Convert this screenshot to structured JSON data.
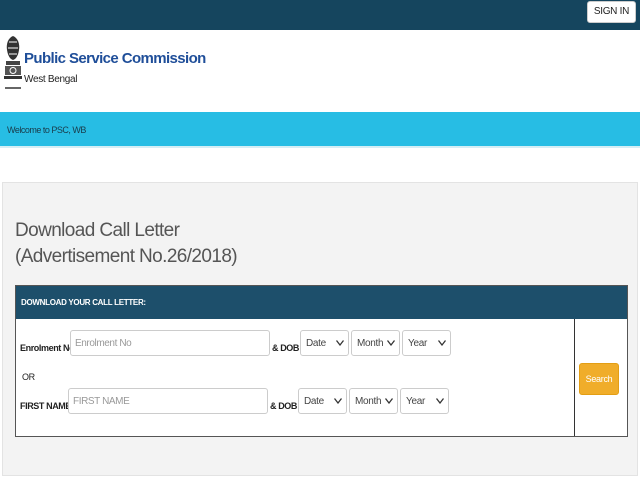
{
  "topbar": {
    "signin_label": "SIGN IN"
  },
  "header": {
    "org_name": "Public Service Commission",
    "org_region": "West Bengal"
  },
  "welcome": {
    "text": "Welcome to PSC, WB"
  },
  "page": {
    "title_line1": "Download Call Letter",
    "title_line2": "(Advertisement No.26/2018)"
  },
  "form": {
    "heading": "DOWNLOAD YOUR CALL LETTER:",
    "enrolment_label": "Enrolment No :",
    "enrolment_placeholder": "Enrolment No",
    "dob_label": "& DOB :",
    "or_label": "OR",
    "firstname_label": "FIRST NAME :",
    "firstname_placeholder": "FIRST NAME",
    "date_option": "Date",
    "month_option": "Month",
    "year_option": "Year",
    "search_label": "Search"
  },
  "colors": {
    "topbar": "#15455e",
    "brand": "#1f4e99",
    "welcome_bar": "#27bde4",
    "form_header": "#1d4f6b",
    "search_button": "#f0ad2a"
  }
}
